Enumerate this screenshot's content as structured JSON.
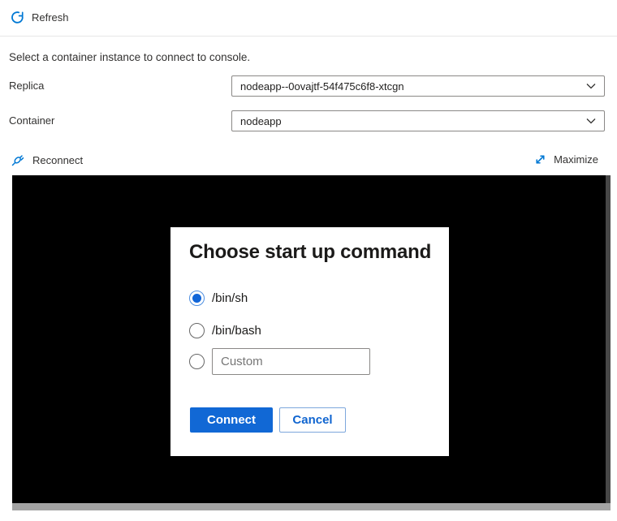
{
  "toolbar": {
    "refresh_label": "Refresh"
  },
  "description": "Select a container instance to connect to console.",
  "form": {
    "replica": {
      "label": "Replica",
      "value": "nodeapp--0ovajtf-54f475c6f8-xtcgn"
    },
    "container": {
      "label": "Container",
      "value": "nodeapp"
    }
  },
  "console_toolbar": {
    "reconnect_label": "Reconnect",
    "maximize_label": "Maximize"
  },
  "dialog": {
    "title": "Choose start up command",
    "options": [
      {
        "label": "/bin/sh",
        "selected": true
      },
      {
        "label": "/bin/bash",
        "selected": false
      },
      {
        "label": "custom",
        "selected": false
      }
    ],
    "custom_placeholder": "Custom",
    "connect_label": "Connect",
    "cancel_label": "Cancel"
  },
  "colors": {
    "icon_blue": "#0078d4",
    "button_blue": "#1168d5",
    "text": "#323130",
    "console_background": "#000000",
    "scrollbar_gray": "#a3a3a3"
  }
}
